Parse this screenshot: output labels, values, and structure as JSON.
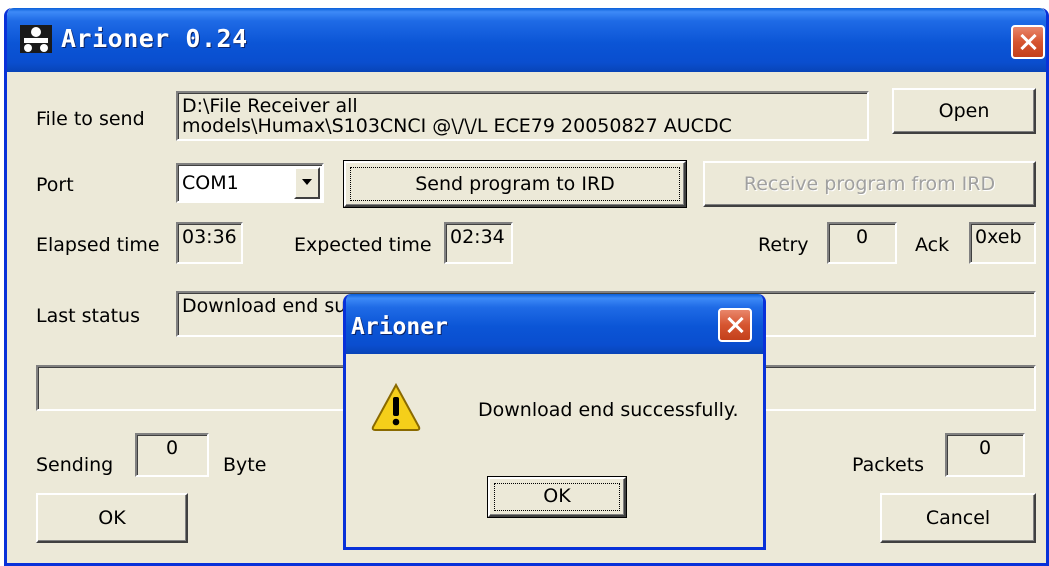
{
  "window": {
    "title": "Arioner 0.24"
  },
  "file": {
    "label": "File to send",
    "value_line1": "D:\\File Receiver all",
    "value_line2": "models\\Humax\\S103CNCI  @\\/\\/L  ECE79  20050827  AUCDC",
    "open_label": "Open"
  },
  "port": {
    "label": "Port",
    "selected": "COM1",
    "send_label": "Send program to IRD",
    "receive_label": "Receive program from IRD"
  },
  "times": {
    "elapsed_label": "Elapsed time",
    "elapsed_value": "03:36",
    "expected_label": "Expected time",
    "expected_value": "02:34",
    "retry_label": "Retry",
    "retry_value": "0",
    "ack_label": "Ack",
    "ack_value": "0xeb"
  },
  "status": {
    "label": "Last status",
    "value": "Download end su"
  },
  "progress": {
    "fraction": 0
  },
  "sending": {
    "label": "Sending",
    "value": "0",
    "unit": "Byte",
    "packets_label": "Packets",
    "packets_value": "0"
  },
  "footer": {
    "ok_label": "OK",
    "cancel_label": "Cancel"
  },
  "dialog": {
    "title": "Arioner",
    "message": "Download end successfully.",
    "ok_label": "OK",
    "icon": "warning-icon"
  },
  "colors": {
    "titlebar": "#0b55d6",
    "close": "#d65530",
    "face": "#ece9d8"
  }
}
